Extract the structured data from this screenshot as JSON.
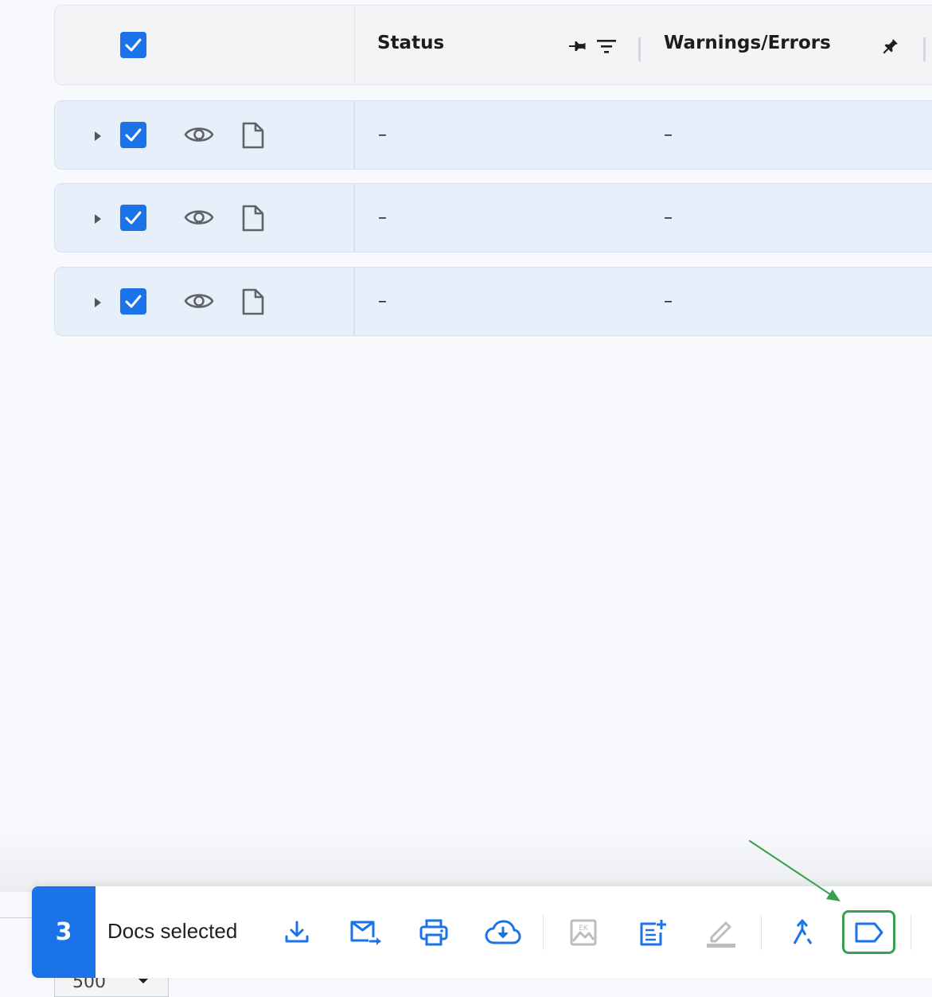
{
  "table": {
    "columns": [
      {
        "label": "Status"
      },
      {
        "label": "Warnings/Errors"
      }
    ],
    "rows": [
      {
        "status": "–",
        "warnings": "–"
      },
      {
        "status": "–",
        "warnings": "–"
      },
      {
        "status": "–",
        "warnings": "–"
      }
    ]
  },
  "pager": {
    "page_size": "500"
  },
  "selection_toolbar": {
    "count": "3",
    "label": "Docs selected",
    "actions": [
      {
        "icon": "download-icon"
      },
      {
        "icon": "email-forward-icon"
      },
      {
        "icon": "print-icon"
      },
      {
        "icon": "cloud-download-icon"
      },
      {
        "icon": "image-icon",
        "disabled": true
      },
      {
        "icon": "note-add-icon"
      },
      {
        "icon": "edit-icon",
        "disabled": true
      },
      {
        "icon": "merge-icon"
      },
      {
        "icon": "label-tag-icon",
        "highlighted": true
      }
    ]
  },
  "colors": {
    "primary": "#1a73e8",
    "row_background": "#e7effb",
    "highlight_border": "#37a24e",
    "annotation_arrow": "#37a24e",
    "disabled_icon": "#bdbdbd"
  }
}
